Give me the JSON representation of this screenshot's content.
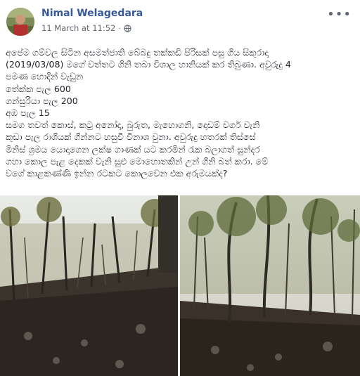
{
  "post": {
    "author": "Nimal Welagedara",
    "timestamp": "11 March at 11:52",
    "separator": "·",
    "privacy_icon": "globe-icon",
    "more_icon": "more-options-icon",
    "more_label": "•••",
    "lines": [
      "අපේම ගම්වල සිටින අසමත්ජාති බේබදු තක්කඩි පිරිසක් පසු ගිය සිකුරාදා",
      "(2019/03/08) මගේ වත්තට ගිනි තබා විශාල හානියක් කර තිබුණා. අවුරුදු 4",
      "පමණ හොදින් වැඩුන",
      "තේක්ක පැල 600",
      "ගන්සුරියා පැල 200",
      "අඹ පැල 15",
      "සමග තවත් කොස්, කටු අනෝදා, බුරුත, මැහොගනි, දොඩම් වර්ග වැනි",
      "කුඩා පැල රාශියක් ගින්නට හසුවී විනාශ වුනා. අවුරුදු හතරක් තිස්සේ",
      "මිනිස් ශ්‍රමය යොදාගෙන ලක්ෂ ගාණක් යට කරමින් රැක බලාගත් සුන්දර",
      "ගහා කොල පැළ දෙකක් වැනි සුළු මොහොතකින් උන් ගිනි බත් කරා. මේ",
      "වගේ කාළකණ්ණි ඉන්න රටකට කොලවෙන එක අරුමයක්ද?"
    ]
  },
  "photos": [
    {
      "icon": "burnt-forest-photo-left"
    },
    {
      "icon": "burnt-forest-photo-right"
    }
  ],
  "colors": {
    "author": "#365899",
    "meta": "#616770",
    "text": "#1d2129"
  }
}
